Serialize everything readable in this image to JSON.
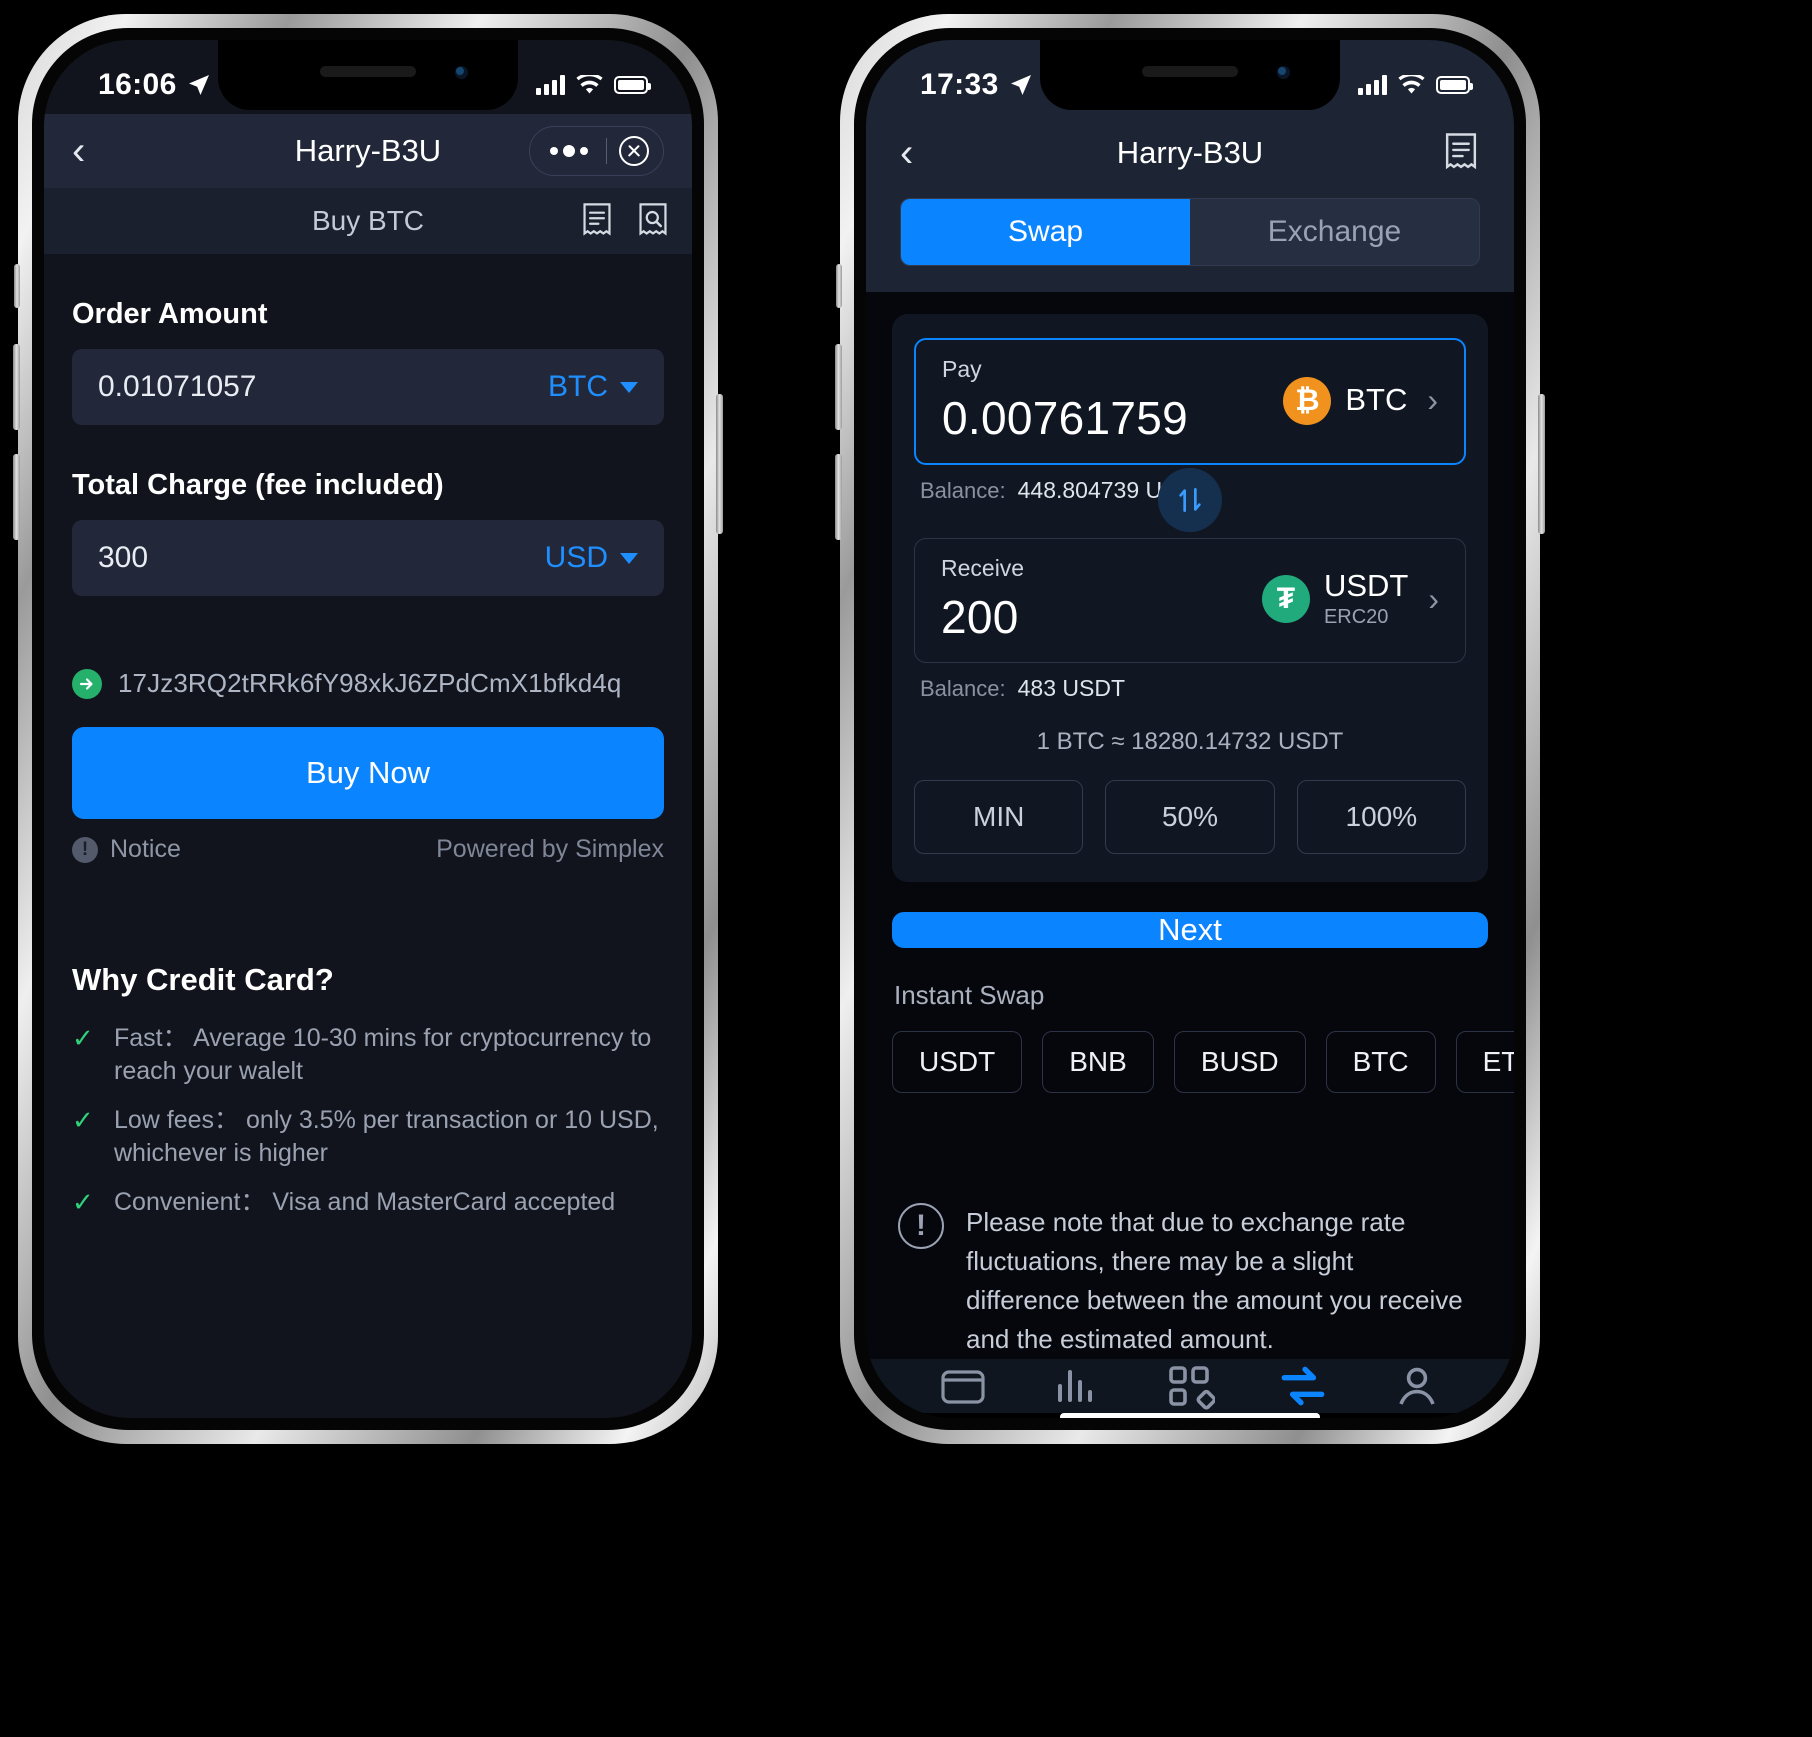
{
  "left_phone": {
    "status": {
      "time": "16:06",
      "location_icon": "location-arrow-icon"
    },
    "navbar": {
      "back_icon": "chevron-left-icon",
      "title": "Harry-B3U",
      "more_icon": "more-dots-icon",
      "close_icon": "close-circle-icon"
    },
    "subbar": {
      "title": "Buy BTC",
      "orders_icon": "receipt-icon",
      "search_icon": "receipt-search-icon"
    },
    "order_amount": {
      "label": "Order Amount",
      "value": "0.01071057",
      "unit": "BTC",
      "chevron_icon": "chevron-down-icon"
    },
    "total_charge": {
      "label": "Total Charge (fee included)",
      "value": "300",
      "unit": "USD",
      "chevron_icon": "chevron-down-icon"
    },
    "address": {
      "icon": "green-arrow-right-icon",
      "value": "17Jz3RQ2tRRk6fY98xkJ6ZPdCmX1bfkd4q"
    },
    "buy_button": "Buy Now",
    "notice": {
      "icon": "exclamation-icon",
      "label": "Notice"
    },
    "powered_by": "Powered by Simplex",
    "why": {
      "title": "Why Credit Card?",
      "items": [
        "Fast： Average 10-30 mins for cryptocurrency to reach your walelt",
        "Low fees： only 3.5% per transaction or 10 USD, whichever is higher",
        "Convenient： Visa and MasterCard accepted"
      ]
    }
  },
  "right_phone": {
    "status": {
      "time": "17:33",
      "location_icon": "location-arrow-icon"
    },
    "navbar": {
      "back_icon": "chevron-left-icon",
      "title": "Harry-B3U",
      "history_icon": "receipt-icon"
    },
    "tabs": [
      {
        "label": "Swap",
        "active": true
      },
      {
        "label": "Exchange",
        "active": false
      }
    ],
    "pay": {
      "label": "Pay",
      "value": "0.00761759",
      "coin": "BTC",
      "coin_icon": "bitcoin-icon",
      "chevron_icon": "chevron-right-icon",
      "balance_label": "Balance:",
      "balance_value": "448.804739 USDT"
    },
    "swap_toggle_icon": "swap-vertical-icon",
    "receive": {
      "label": "Receive",
      "value": "200",
      "coin": "USDT",
      "coin_network": "ERC20",
      "coin_icon": "tether-icon",
      "chevron_icon": "chevron-right-icon",
      "balance_label": "Balance:",
      "balance_value": "483 USDT"
    },
    "rate": "1 BTC  ≈  18280.14732 USDT",
    "percent_buttons": [
      "MIN",
      "50%",
      "100%"
    ],
    "next_button": "Next",
    "instant_swap": {
      "title": "Instant Swap",
      "chips": [
        "USDT",
        "BNB",
        "BUSD",
        "BTC",
        "ETH"
      ]
    },
    "note": {
      "icon": "exclamation-circle-icon",
      "text": "Please note that due to exchange rate fluctuations, there may be a slight difference between the amount you receive and the estimated amount."
    },
    "tabbar": [
      {
        "name": "wallet-icon",
        "active": false
      },
      {
        "name": "chart-icon",
        "active": false
      },
      {
        "name": "apps-grid-icon",
        "active": false
      },
      {
        "name": "swap-arrows-icon",
        "active": true
      },
      {
        "name": "profile-icon",
        "active": false
      }
    ]
  },
  "colors": {
    "accent_blue": "#0b84ff",
    "bitcoin_orange": "#f0921d",
    "tether_green": "#21ab7c",
    "check_green": "#2fd17a"
  }
}
